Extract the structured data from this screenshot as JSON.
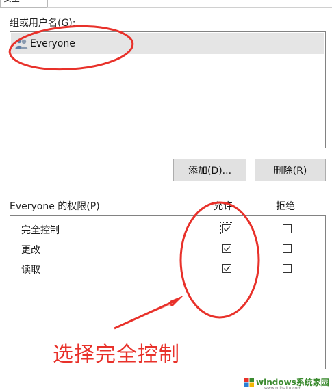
{
  "tabs": {
    "active_label": "安全"
  },
  "users": {
    "label": "组或用户名(G):",
    "items": [
      {
        "name": "Everyone",
        "icon": "users-icon",
        "selected": true
      }
    ]
  },
  "buttons": {
    "add": "添加(D)...",
    "remove": "删除(R)"
  },
  "permissions": {
    "label": "Everyone 的权限(P)",
    "allow_header": "允许",
    "deny_header": "拒绝",
    "rows": [
      {
        "name": "完全控制",
        "allow": true,
        "deny": false,
        "focused": true
      },
      {
        "name": "更改",
        "allow": true,
        "deny": false
      },
      {
        "name": "读取",
        "allow": true,
        "deny": false
      }
    ]
  },
  "annotation": {
    "text": "选择完全控制",
    "color": "#e8312a"
  },
  "watermark": {
    "text": "windows系统家园",
    "url": "www.ruihaitu.com",
    "color": "#3a8a2e"
  }
}
